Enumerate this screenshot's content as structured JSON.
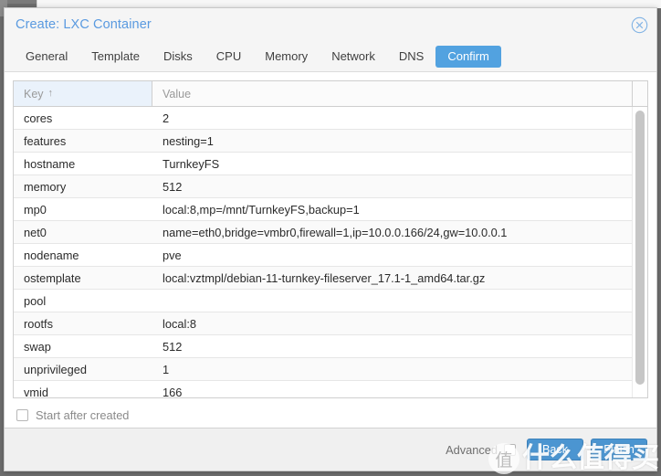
{
  "window": {
    "title": "Create: LXC Container",
    "close_icon": "close-circle-icon"
  },
  "tabs": [
    {
      "label": "General",
      "active": false
    },
    {
      "label": "Template",
      "active": false
    },
    {
      "label": "Disks",
      "active": false
    },
    {
      "label": "CPU",
      "active": false
    },
    {
      "label": "Memory",
      "active": false
    },
    {
      "label": "Network",
      "active": false
    },
    {
      "label": "DNS",
      "active": false
    },
    {
      "label": "Confirm",
      "active": true
    }
  ],
  "grid": {
    "columns": [
      {
        "label": "Key",
        "sorted": true,
        "sort_indicator": "↑"
      },
      {
        "label": "Value",
        "sorted": false,
        "sort_indicator": ""
      }
    ],
    "rows": [
      {
        "key": "cores",
        "value": "2"
      },
      {
        "key": "features",
        "value": "nesting=1"
      },
      {
        "key": "hostname",
        "value": "TurnkeyFS"
      },
      {
        "key": "memory",
        "value": "512"
      },
      {
        "key": "mp0",
        "value": "local:8,mp=/mnt/TurnkeyFS,backup=1"
      },
      {
        "key": "net0",
        "value": "name=eth0,bridge=vmbr0,firewall=1,ip=10.0.0.166/24,gw=10.0.0.1"
      },
      {
        "key": "nodename",
        "value": "pve"
      },
      {
        "key": "ostemplate",
        "value": "local:vztmpl/debian-11-turnkey-fileserver_17.1-1_amd64.tar.gz"
      },
      {
        "key": "pool",
        "value": ""
      },
      {
        "key": "rootfs",
        "value": "local:8"
      },
      {
        "key": "swap",
        "value": "512"
      },
      {
        "key": "unprivileged",
        "value": "1"
      },
      {
        "key": "vmid",
        "value": "166"
      }
    ]
  },
  "options": {
    "start_after_created_label": "Start after created",
    "start_after_created_checked": false
  },
  "footer": {
    "advanced_label": "Advanced",
    "advanced_checked": false,
    "back_label": "Back",
    "finish_label": "Finish"
  },
  "watermark": {
    "badge": "值",
    "text": "什么值得买"
  },
  "colors": {
    "accent": "#4b95d1",
    "title": "#5a9ae0",
    "active_tab": "#52a2e0",
    "sorted_column": "#eaf2fb"
  }
}
